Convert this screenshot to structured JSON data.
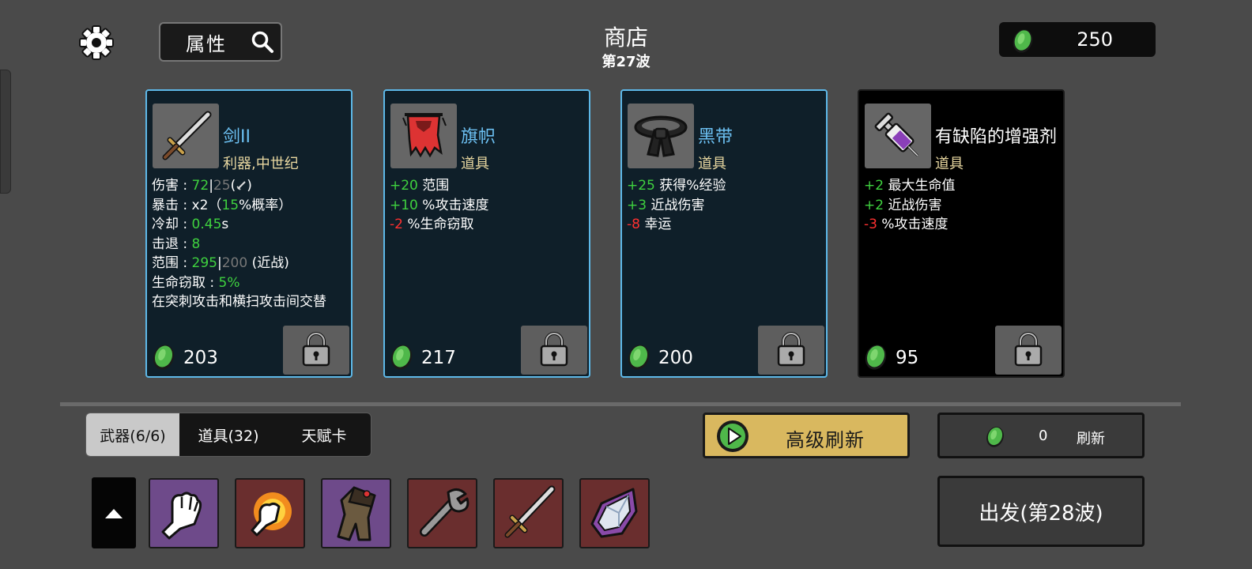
{
  "header": {
    "title": "商店",
    "wave": "第27波",
    "stats_button": "属性",
    "coins": "250"
  },
  "cards": [
    {
      "name": "剑II",
      "type": "利器,中世纪",
      "price": "203",
      "style": "blue",
      "stats": {
        "damage_label": "伤害 : ",
        "damage_value": "72",
        "damage_sep": "|",
        "damage_base": "25",
        "damage_suffix": ")",
        "crit_label": "暴击 : ",
        "crit_mult": "x2（",
        "crit_pct": "15",
        "crit_suffix": "%概率）",
        "cooldown_label": "冷却 : ",
        "cooldown_value": "0.45",
        "cooldown_unit": "s",
        "knockback_label": "击退 : ",
        "knockback_value": "8",
        "range_label": "范围 : ",
        "range_value": "295",
        "range_sep": "|",
        "range_base": "200",
        "range_suffix": " (近战)",
        "lifesteal_label": "生命窃取 : ",
        "lifesteal_value": "5%",
        "description": "在突刺攻击和横扫攻击间交替"
      }
    },
    {
      "name": "旗帜",
      "type": "道具",
      "price": "217",
      "style": "blue",
      "effects": [
        {
          "value": "+20",
          "text": " 范围",
          "color": "green"
        },
        {
          "value": "+10",
          "text": " %攻击速度",
          "color": "green"
        },
        {
          "value": "-2",
          "text": " %生命窃取",
          "color": "red"
        }
      ]
    },
    {
      "name": "黑带",
      "type": "道具",
      "price": "200",
      "style": "blue",
      "effects": [
        {
          "value": "+25",
          "text": " 获得%经验",
          "color": "green"
        },
        {
          "value": "+3",
          "text": " 近战伤害",
          "color": "green"
        },
        {
          "value": "-8",
          "text": " 幸运",
          "color": "red"
        }
      ]
    },
    {
      "name": "有缺陷的增强剂",
      "type": "道具",
      "price": "95",
      "style": "black",
      "effects": [
        {
          "value": "+2",
          "text": " 最大生命值",
          "color": "green"
        },
        {
          "value": "+2",
          "text": " 近战伤害",
          "color": "green"
        },
        {
          "value": "-3",
          "text": " %攻击速度",
          "color": "red"
        }
      ]
    }
  ],
  "tabs": [
    {
      "label": "武器(6/6)",
      "active": true
    },
    {
      "label": "道具(32)",
      "active": false
    },
    {
      "label": "天赋卡",
      "active": false
    }
  ],
  "advanced_refresh_label": "高级刷新",
  "refresh": {
    "cost": "0",
    "label": "刷新"
  },
  "go_button": "出发(第28波)",
  "inventory": [
    {
      "icon": "fist-icon",
      "rarity": "purple"
    },
    {
      "icon": "flaming-fist-icon",
      "rarity": "red"
    },
    {
      "icon": "gauntlet-icon",
      "rarity": "purple"
    },
    {
      "icon": "wrench-icon",
      "rarity": "red"
    },
    {
      "icon": "sword-icon",
      "rarity": "red"
    },
    {
      "icon": "crystal-shard-icon",
      "rarity": "red"
    }
  ],
  "colors": {
    "background": "#4a4a4a",
    "card_blue_bg": "#0f1f29",
    "card_border": "#5db8e8",
    "stat_green": "#3fd13f",
    "stat_red": "#ff3030",
    "item_type": "#e8d7a0",
    "advanced_refresh": "#d9b85f",
    "coin": "#4fb84a"
  }
}
